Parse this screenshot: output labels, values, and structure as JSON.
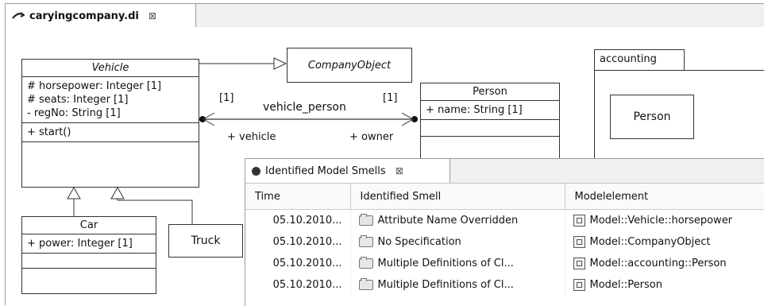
{
  "editor": {
    "tab_title": "caryingcompany.di",
    "tab_close": "⊠"
  },
  "diagram": {
    "vehicle": {
      "name": "Vehicle",
      "attrs": [
        "# horsepower: Integer [1]",
        "# seats: Integer [1]",
        "- regNo: String [1]"
      ],
      "ops": [
        "+ start()"
      ]
    },
    "company_object": {
      "name": "CompanyObject"
    },
    "person": {
      "name": "Person",
      "attrs": [
        "+ name: String [1]"
      ]
    },
    "car": {
      "name": "Car",
      "attrs": [
        "+ power: Integer [1]"
      ]
    },
    "truck": {
      "name": "Truck"
    },
    "accounting": {
      "name": "accounting",
      "inner": "Person"
    },
    "association": {
      "name": "vehicle_person",
      "mult_left": "[1]",
      "mult_right": "[1]",
      "role_left": "+ vehicle",
      "role_right": "+ owner"
    }
  },
  "smells_view": {
    "tab_title": "Identified Model Smells",
    "tab_close": "⊠",
    "columns": [
      "Time",
      "Identified Smell",
      "Modelelement"
    ],
    "rows": [
      {
        "time": "05.10.2010...",
        "smell": "Attribute Name Overridden",
        "element": "Model::Vehicle::horsepower"
      },
      {
        "time": "05.10.2010...",
        "smell": "No Specification",
        "element": "Model::CompanyObject"
      },
      {
        "time": "05.10.2010...",
        "smell": "Multiple Definitions of Cl...",
        "element": "Model::accounting::Person"
      },
      {
        "time": "05.10.2010...",
        "smell": "Multiple Definitions of Cl...",
        "element": "Model::Person"
      }
    ]
  }
}
